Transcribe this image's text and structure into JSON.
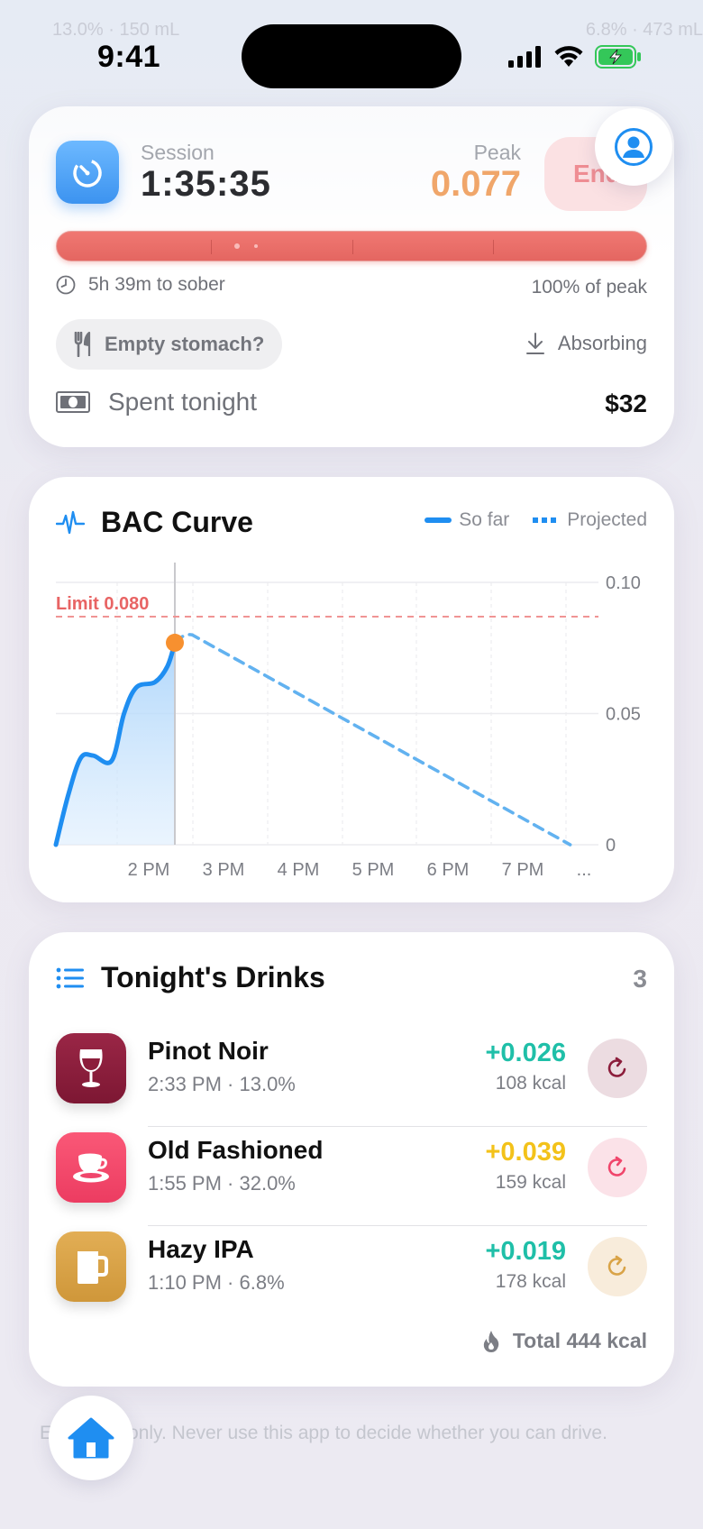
{
  "ghost": {
    "left": "13.0% · 150 mL",
    "right": "6.8% · 473 mL"
  },
  "status_bar": {
    "time": "9:41"
  },
  "session": {
    "label": "Session",
    "elapsed": "1:35:35",
    "peak_label": "Peak",
    "peak_value": "0.077",
    "end_label": "End",
    "progress_fraction": 1.0,
    "to_sober": "5h 39m to sober",
    "percent_of_peak": "100% of peak",
    "stomach_button": "Empty stomach?",
    "absorbing": "Absorbing",
    "spent_label": "Spent tonight",
    "spent_value": "$32"
  },
  "bac_card": {
    "title": "BAC Curve",
    "legend_so_far": "So far",
    "legend_projected": "Projected",
    "limit_label": "Limit 0.080"
  },
  "chart_data": {
    "type": "line",
    "title": "BAC Curve",
    "x_tick_labels": [
      "2 PM",
      "3 PM",
      "4 PM",
      "5 PM",
      "6 PM",
      "7 PM",
      "..."
    ],
    "y_tick_labels": [
      "0.10",
      "0.05",
      "0"
    ],
    "ylim": [
      0,
      0.1
    ],
    "grid": true,
    "legend_placement": "top-right",
    "limit": 0.08,
    "series": [
      {
        "name": "So far",
        "style": "solid",
        "color": "#1f8ef1",
        "points": [
          [
            "1:00 PM",
            0.0
          ],
          [
            "1:10 PM",
            0.019
          ],
          [
            "1:20 PM",
            0.033
          ],
          [
            "1:30 PM",
            0.034
          ],
          [
            "1:45 PM",
            0.032
          ],
          [
            "1:55 PM",
            0.05
          ],
          [
            "2:05 PM",
            0.06
          ],
          [
            "2:20 PM",
            0.062
          ],
          [
            "2:30 PM",
            0.068
          ],
          [
            "2:36 PM",
            0.077
          ]
        ]
      },
      {
        "name": "Projected",
        "style": "dashed",
        "color": "#62b2f0",
        "points": [
          [
            "2:36 PM",
            0.077
          ],
          [
            "2:50 PM",
            0.08
          ],
          [
            "7:55 PM",
            0.0
          ]
        ]
      }
    ]
  },
  "drinks_card": {
    "title": "Tonight's Drinks",
    "count": "3",
    "items": [
      {
        "name": "Pinot Noir",
        "meta": "2:33 PM · 13.0%",
        "delta": "+0.026",
        "kcal": "108 kcal",
        "icon": "wine-glass-icon",
        "color": "#8c1d3b",
        "delta_color": "#1fbfa8"
      },
      {
        "name": "Old Fashioned",
        "meta": "1:55 PM · 32.0%",
        "delta": "+0.039",
        "kcal": "159 kcal",
        "icon": "cocktail-cup-icon",
        "color": "#f0456b",
        "delta_color": "#f3c21a"
      },
      {
        "name": "Hazy IPA",
        "meta": "1:10 PM · 6.8%",
        "delta": "+0.019",
        "kcal": "178 kcal",
        "icon": "beer-mug-icon",
        "color": "#d9a347",
        "delta_color": "#1fbfa8"
      }
    ],
    "total": "Total 444 kcal"
  },
  "disclaimer": "Estimates only. Never use this app to decide whether you can drive."
}
